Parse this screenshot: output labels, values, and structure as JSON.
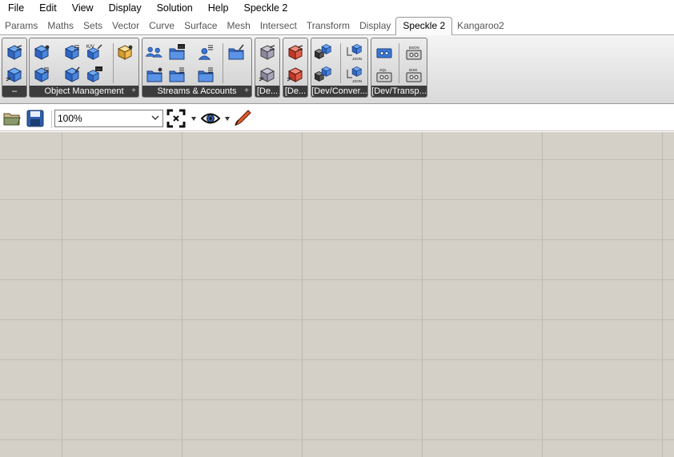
{
  "menu": {
    "items": [
      "File",
      "Edit",
      "View",
      "Display",
      "Solution",
      "Help",
      "Speckle 2"
    ]
  },
  "tabs": [
    "Params",
    "Maths",
    "Sets",
    "Vector",
    "Curve",
    "Surface",
    "Mesh",
    "Intersect",
    "Transform",
    "Display",
    "Speckle 2",
    "Kangaroo2"
  ],
  "active_tab": "Speckle 2",
  "ribbon": {
    "panels": [
      {
        "label": "–"
      },
      {
        "label": "Object Management",
        "expand": "+"
      },
      {
        "label": "Streams & Accounts",
        "expand": "+"
      },
      {
        "label": "[De..."
      },
      {
        "label": "[De..."
      },
      {
        "label": "[Dev/Conver..."
      },
      {
        "label": "[Dev/Transp..."
      }
    ],
    "icon_text": {
      "kv": "K/V",
      "dots": "···",
      "json": "JSON",
      "bson": "BSON",
      "sql": "SQL",
      "disk": "DISK"
    }
  },
  "toolbar": {
    "zoom_value": "100%"
  },
  "colors": {
    "canvas": "#d4d0c8",
    "gridline": "#bdb9b1",
    "speckle_blue": "#3a78d8",
    "panel_label_bg": "#3c3c3c"
  }
}
